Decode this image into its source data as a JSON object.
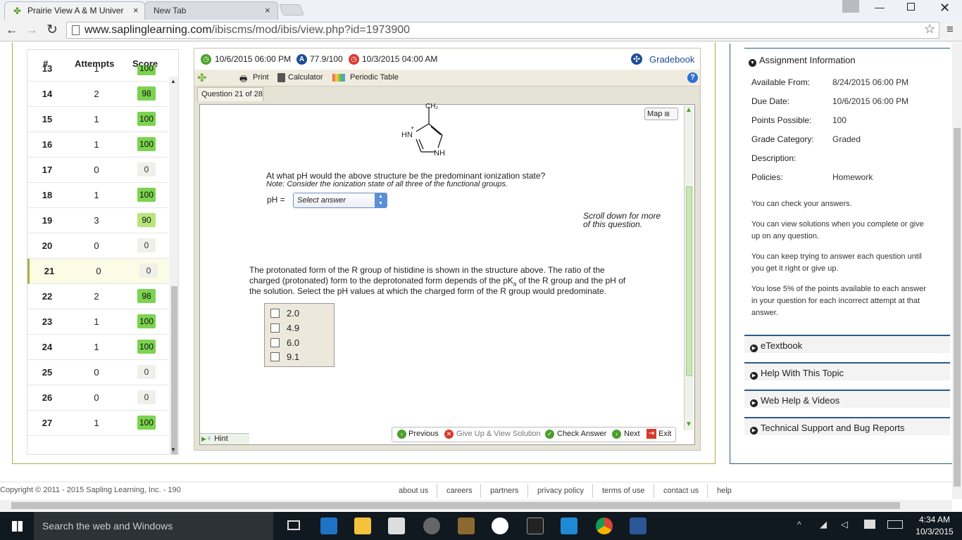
{
  "browser": {
    "tabs": [
      {
        "label": "Prairie View A & M Univer",
        "close": "×"
      },
      {
        "label": "New Tab",
        "close": "×"
      }
    ],
    "url_host": "www.saplinglearning.com",
    "url_path": "/ibiscms/mod/ibis/view.php?id=1973900"
  },
  "left_panel": {
    "headers": {
      "num": "#",
      "attempts": "Attempts",
      "score": "Score"
    },
    "rows": [
      {
        "num": "13",
        "attempts": "1",
        "score": "100",
        "level": "full"
      },
      {
        "num": "14",
        "attempts": "2",
        "score": "98",
        "level": "full"
      },
      {
        "num": "15",
        "attempts": "1",
        "score": "100",
        "level": "full"
      },
      {
        "num": "16",
        "attempts": "1",
        "score": "100",
        "level": "full"
      },
      {
        "num": "17",
        "attempts": "0",
        "score": "0",
        "level": "zero"
      },
      {
        "num": "18",
        "attempts": "1",
        "score": "100",
        "level": "full"
      },
      {
        "num": "19",
        "attempts": "3",
        "score": "90",
        "level": "mid"
      },
      {
        "num": "20",
        "attempts": "0",
        "score": "0",
        "level": "zero"
      },
      {
        "num": "21",
        "attempts": "0",
        "score": "0",
        "level": "zero"
      },
      {
        "num": "22",
        "attempts": "2",
        "score": "98",
        "level": "full"
      },
      {
        "num": "23",
        "attempts": "1",
        "score": "100",
        "level": "full"
      },
      {
        "num": "24",
        "attempts": "1",
        "score": "100",
        "level": "full"
      },
      {
        "num": "25",
        "attempts": "0",
        "score": "0",
        "level": "zero"
      },
      {
        "num": "26",
        "attempts": "0",
        "score": "0",
        "level": "zero"
      },
      {
        "num": "27",
        "attempts": "1",
        "score": "100",
        "level": "full"
      }
    ]
  },
  "center": {
    "due": "10/6/2015 06:00 PM",
    "grade": "77.9/100",
    "late_date": "10/3/2015 04:00 AM",
    "gradebook": "Gradebook",
    "tools": {
      "print": "Print",
      "calculator": "Calculator",
      "periodic": "Periodic Table"
    },
    "question_tab": "Question 21 of 28",
    "map": "Map",
    "molecule": {
      "top": "CH₂",
      "hn": "HN",
      "plus": "+",
      "nh": "NH"
    },
    "q1": "At what pH would the above structure be the predominant ionization state?",
    "q1_note": "Note: Consider the ionization state of all three of the functional groups.",
    "ph_label": "pH =",
    "select_placeholder": "Select answer",
    "scroll_hint_1": "Scroll down for more",
    "scroll_hint_2": "of this question.",
    "q2_line1": "The protonated form of the R group of histidine is shown in the structure above. The ratio of the",
    "q2_line2a": "charged (protonated) form to the deprotonated form depends of the pK",
    "q2_line2sub": "a",
    "q2_line2b": " of the R group and the pH of",
    "q2_line3": "the solution. Select the pH values at which the charged form of the R group would predominate.",
    "answers": [
      "2.0",
      "4.9",
      "6.0",
      "9.1"
    ],
    "hint": "Hint",
    "nav": {
      "previous": "Previous",
      "giveup": "Give Up & View Solution",
      "check": "Check Answer",
      "next": "Next",
      "exit": "Exit"
    }
  },
  "right_panel": {
    "assignment_title": "Assignment Information",
    "fields": [
      {
        "label": "Available From:",
        "value": "8/24/2015 06:00 PM"
      },
      {
        "label": "Due Date:",
        "value": "10/6/2015 06:00 PM"
      },
      {
        "label": "Points Possible:",
        "value": "100"
      },
      {
        "label": "Grade Category:",
        "value": "Graded"
      },
      {
        "label": "Description:",
        "value": ""
      },
      {
        "label": "Policies:",
        "value": "Homework"
      }
    ],
    "policy1": "You can check your answers.",
    "policy2a": "You can view solutions when you complete or give",
    "policy2b": "up on any question.",
    "policy3a": "You can keep trying to answer each question until",
    "policy3b": "you get it right or give up.",
    "policy4a": "You lose 5% of the points available to each answer",
    "policy4b": "in your question for each incorrect attempt at that",
    "policy4c": "answer.",
    "sections": [
      "eTextbook",
      "Help With This Topic",
      "Web Help & Videos",
      "Technical Support and Bug Reports"
    ]
  },
  "footer": {
    "copyright": "Copyright © 2011 - 2015 Sapling Learning, Inc. - 190",
    "links": [
      "about us",
      "careers",
      "partners",
      "privacy policy",
      "terms of use",
      "contact us",
      "help"
    ]
  },
  "taskbar": {
    "search": "Search the web and Windows",
    "time": "4:34 AM",
    "date": "10/3/2015"
  },
  "colors": {
    "accent": "#2a5a8a",
    "olive_border": "#a8b04a",
    "score_full": "#7bd34f"
  }
}
